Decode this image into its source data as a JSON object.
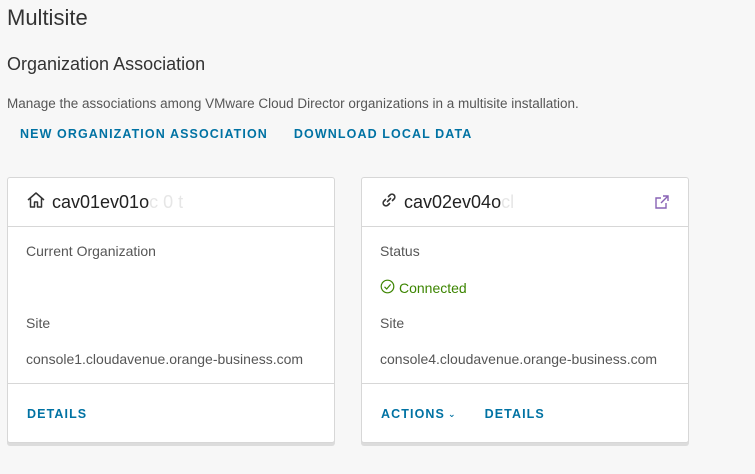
{
  "page": {
    "title": "Multisite",
    "section_title": "Organization Association",
    "description": "Manage the associations among VMware Cloud Director organizations in a multisite installation."
  },
  "toolbar": {
    "new_association_label": "NEW ORGANIZATION ASSOCIATION",
    "download_label": "DOWNLOAD LOCAL DATA"
  },
  "cards": [
    {
      "icon": "home-icon",
      "title": "cav01ev01o",
      "title_faded": "c  0     t",
      "first_field_label": "Current Organization",
      "site_label": "Site",
      "site_value": "console1.cloudavenue.orange-business.com",
      "details_label": "DETAILS"
    },
    {
      "icon": "link-icon",
      "title": "cav02ev04o",
      "title_faded": "cl         ",
      "status_label": "Status",
      "status_value": "Connected",
      "site_label": "Site",
      "site_value": "console4.cloudavenue.orange-business.com",
      "actions_label": "ACTIONS",
      "details_label": "DETAILS"
    }
  ],
  "colors": {
    "link": "#0072a3",
    "connected": "#3c8500",
    "external_link_icon": "#8963b5"
  }
}
